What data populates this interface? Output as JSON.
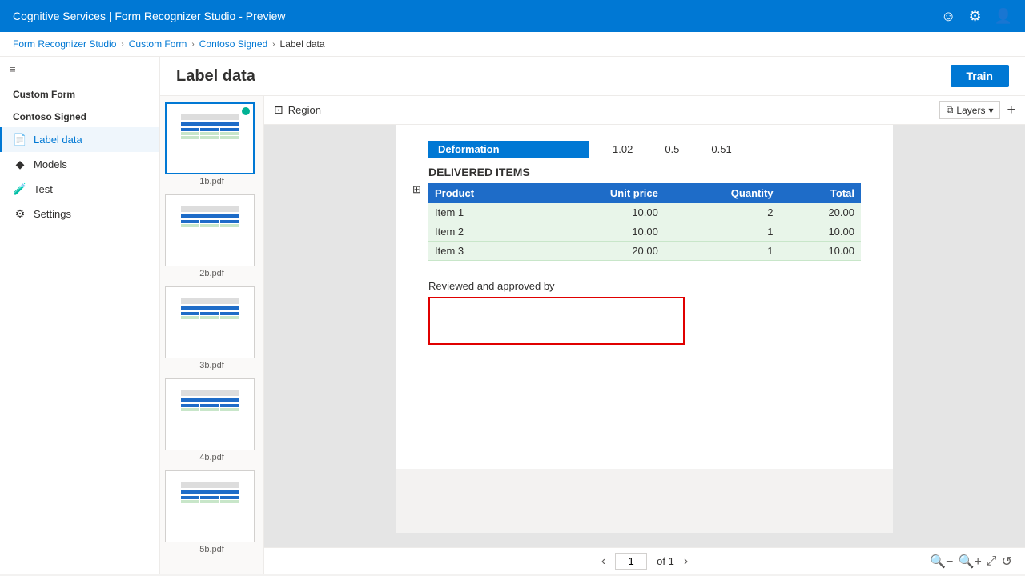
{
  "app": {
    "title": "Cognitive Services | Form Recognizer Studio - Preview"
  },
  "topbar": {
    "title": "Cognitive Services | Form Recognizer Studio - Preview",
    "icons": [
      "smiley",
      "settings",
      "user"
    ]
  },
  "breadcrumb": {
    "items": [
      "Form Recognizer Studio",
      "Custom Form",
      "Contoso Signed",
      "Label data"
    ]
  },
  "sidebar": {
    "collapse_icon": "≡",
    "section_label": "Custom Form",
    "group_label": "Contoso Signed",
    "items": [
      {
        "id": "label-data",
        "label": "Label data",
        "icon": "📄",
        "active": true
      },
      {
        "id": "models",
        "label": "Models",
        "icon": "🔷",
        "active": false
      },
      {
        "id": "test",
        "label": "Test",
        "icon": "🧪",
        "active": false
      },
      {
        "id": "settings",
        "label": "Settings",
        "icon": "⚙️",
        "active": false
      }
    ]
  },
  "page_header": {
    "title": "Label data",
    "train_button": "Train"
  },
  "files": [
    {
      "name": "1b.pdf",
      "active": true,
      "dot": true
    },
    {
      "name": "2b.pdf",
      "active": false
    },
    {
      "name": "3b.pdf",
      "active": false
    },
    {
      "name": "4b.pdf",
      "active": false
    },
    {
      "name": "5b.pdf",
      "active": false
    }
  ],
  "toolbar": {
    "region_label": "Region",
    "layers_label": "Layers",
    "add_label": "+"
  },
  "document": {
    "deformation_label": "Deformation",
    "deformation_values": [
      "1.02",
      "0.5",
      "0.51"
    ],
    "delivered_items_title": "DELIVERED ITEMS",
    "table_columns": [
      "Product",
      "Unit price",
      "Quantity",
      "Total"
    ],
    "table_rows": [
      [
        "Item 1",
        "10.00",
        "2",
        "20.00"
      ],
      [
        "Item 2",
        "10.00",
        "1",
        "10.00"
      ],
      [
        "Item 3",
        "20.00",
        "1",
        "10.00"
      ]
    ],
    "reviewed_label": "Reviewed and approved by"
  },
  "pagination": {
    "current_page": "1",
    "total_pages": "1",
    "of_label": "of"
  },
  "zoom": {
    "zoom_in": "+",
    "zoom_out": "-",
    "fit": "⤢",
    "rotate": "↺"
  }
}
